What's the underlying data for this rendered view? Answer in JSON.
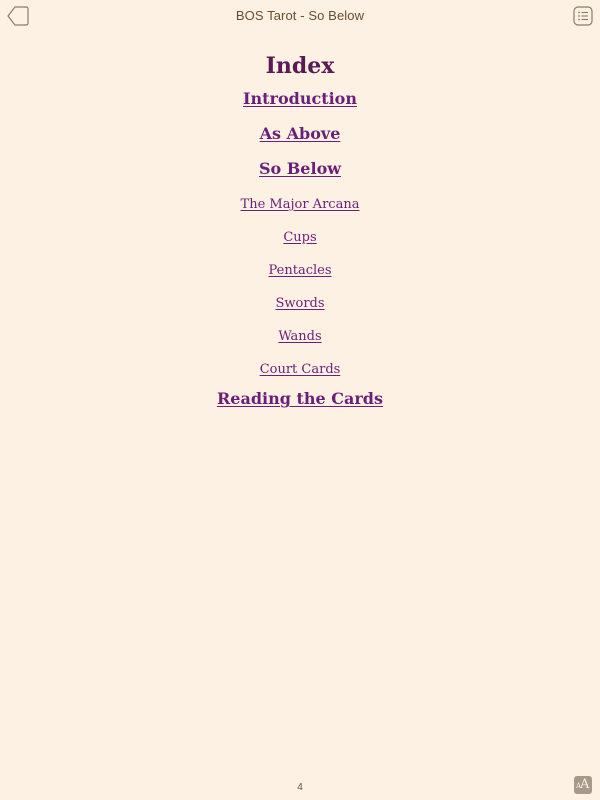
{
  "header": {
    "title": "BOS Tarot - So Below",
    "back_icon": "back-arrow-icon",
    "toc_icon": "table-of-contents-icon"
  },
  "index": {
    "title": "Index",
    "items": [
      {
        "label": "Introduction",
        "style": "major"
      },
      {
        "label": "As Above",
        "style": "major"
      },
      {
        "label": "So Below",
        "style": "major"
      },
      {
        "label": "The Major Arcana",
        "style": "minor"
      },
      {
        "label": "Cups",
        "style": "minor"
      },
      {
        "label": "Pentacles",
        "style": "minor"
      },
      {
        "label": "Swords",
        "style": "minor"
      },
      {
        "label": "Wands",
        "style": "minor"
      },
      {
        "label": "Court Cards",
        "style": "minor"
      },
      {
        "label": "Reading the Cards",
        "style": "major"
      }
    ]
  },
  "footer": {
    "page_number": "4",
    "font_icon": "font-size-icon"
  },
  "colors": {
    "background": "#fcf1e2",
    "link": "#6a1f78",
    "heading": "#5a1a55",
    "chrome_text": "#6b4c32"
  }
}
